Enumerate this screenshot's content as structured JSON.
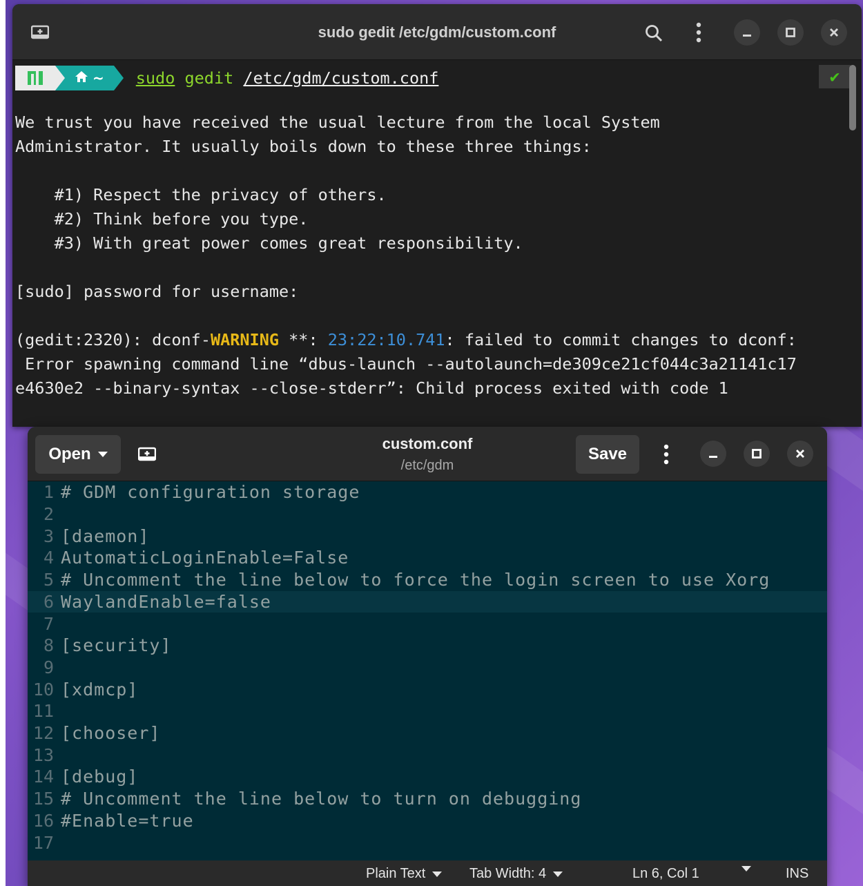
{
  "terminal": {
    "title": "sudo gedit /etc/gdm/custom.conf",
    "prompt": {
      "home_label": "~",
      "cmd_sudo": "sudo",
      "cmd_gedit": "gedit",
      "cmd_path": "/etc/gdm/custom.conf",
      "status_check": "✔"
    },
    "lines": [
      "We trust you have received the usual lecture from the local System",
      "Administrator. It usually boils down to these three things:",
      "    #1) Respect the privacy of others.",
      "    #2) Think before you type.",
      "    #3) With great power comes great responsibility.",
      "[sudo] password for username:"
    ],
    "warning": {
      "prefix": "(gedit:2320): dconf-",
      "level": "WARNING",
      "mid": " **: ",
      "time": "23:22:10.741",
      "msg": ": failed to commit changes to dconf:"
    },
    "error_lines": [
      " Error spawning command line “dbus-launch --autolaunch=de309ce21cf044c3a21141c17",
      "e4630e2 --binary-syntax --close-stderr”: Child process exited with code 1"
    ]
  },
  "gedit": {
    "open_label": "Open",
    "save_label": "Save",
    "title": "custom.conf",
    "subtitle": "/etc/gdm",
    "current_line": 6,
    "lines": [
      {
        "n": "1",
        "t": "# GDM configuration storage"
      },
      {
        "n": "2",
        "t": ""
      },
      {
        "n": "3",
        "t": "[daemon]"
      },
      {
        "n": "4",
        "t": "AutomaticLoginEnable=False"
      },
      {
        "n": "5",
        "t": "# Uncomment the line below to force the login screen to use Xorg"
      },
      {
        "n": "6",
        "t": "WaylandEnable=false"
      },
      {
        "n": "7",
        "t": ""
      },
      {
        "n": "8",
        "t": "[security]"
      },
      {
        "n": "9",
        "t": ""
      },
      {
        "n": "10",
        "t": "[xdmcp]"
      },
      {
        "n": "11",
        "t": ""
      },
      {
        "n": "12",
        "t": "[chooser]"
      },
      {
        "n": "13",
        "t": ""
      },
      {
        "n": "14",
        "t": "[debug]"
      },
      {
        "n": "15",
        "t": "# Uncomment the line below to turn on debugging"
      },
      {
        "n": "16",
        "t": "#Enable=true"
      },
      {
        "n": "17",
        "t": ""
      }
    ],
    "status": {
      "syntax": "Plain Text",
      "tab_width": "Tab Width: 4",
      "position": "Ln 6, Col 1",
      "mode": "INS"
    }
  },
  "colors": {
    "terminal_bg": "#1e1e1e",
    "prompt_green": "#8ed82c",
    "warning_yellow": "#e8b918",
    "timestamp_blue": "#3d8fd8",
    "editor_bg": "#002b36",
    "editor_text": "#93a1a1",
    "line_number": "#586e75"
  }
}
